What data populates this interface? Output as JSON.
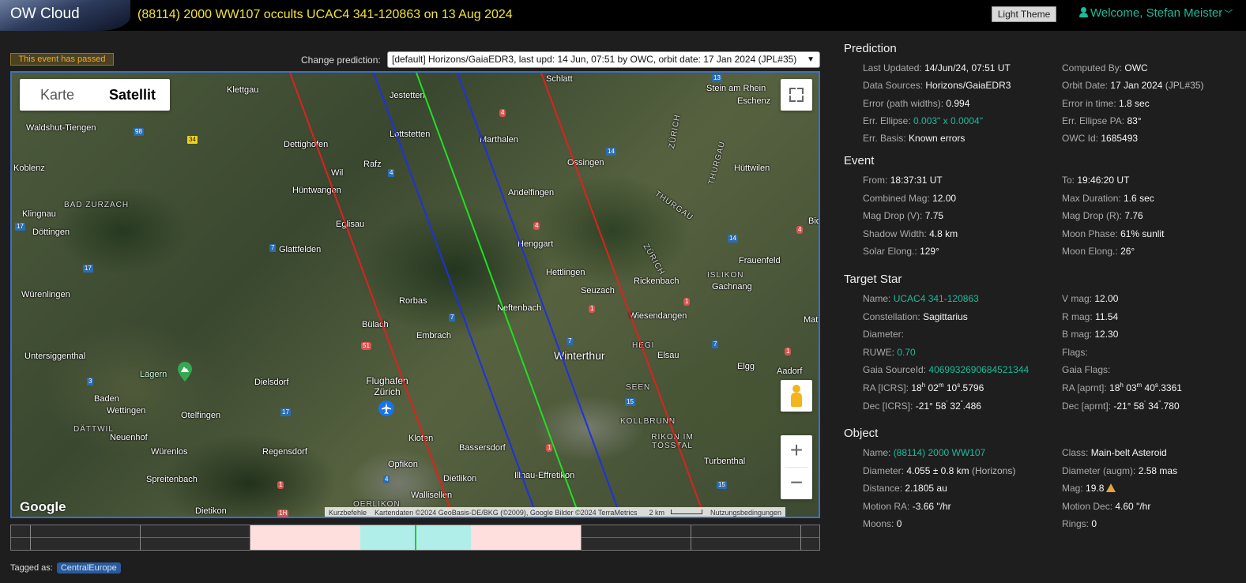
{
  "header": {
    "brand": "OW Cloud",
    "event_title": "(88114) 2000 WW107 occults UCAC4 341-120863 on 13 Aug 2024",
    "theme_button": "Light Theme",
    "welcome": "Welcome, Stefan Meister"
  },
  "controls": {
    "passed_badge": "This event has passed",
    "change_label": "Change prediction:",
    "prediction_selected": "[default] Horizons/GaiaEDR3, last upd: 14 Jun, 07:51 by OWC, orbit date: 17 Jan 2024 (JPL#35)"
  },
  "map": {
    "type_options": [
      "Karte",
      "Satellit"
    ],
    "type_selected": "Satellit",
    "google": "Google",
    "attribution": {
      "shortcuts": "Kurzbefehle",
      "data": "Kartendaten ©2024 GeoBasis-DE/BKG (©2009), Google Bilder ©2024 TerraMetrics",
      "scale": "2 km",
      "terms": "Nutzungsbedingungen"
    },
    "places": {
      "klettgau": "Klettgau",
      "waldshut": "Waldshut-Tiengen",
      "dettighofen": "Dettighofen",
      "koblenz": "Koblenz",
      "wil": "Wil",
      "rafz": "Rafz",
      "huentwangen": "Hüntwangen",
      "jestetten": "Jestetten",
      "lottstetten": "Lottstetten",
      "marthalen": "Marthalen",
      "schlatt": "Schlatt",
      "stein": "Stein am Rhein",
      "eschenz": "Eschenz",
      "ossingen": "Ossingen",
      "huettwilen": "Hüttwilen",
      "klingnau": "Klingnau",
      "bad_zurzach": "BAD ZURZACH",
      "doettingen": "Döttingen",
      "eglisau": "Eglisau",
      "andelfingen": "Andelfingen",
      "glattfelden": "Glattfelden",
      "henggart": "Henggart",
      "frauenfeld": "Frauenfeld",
      "wuerenlingen": "Würenlingen",
      "hettlingen": "Hettlingen",
      "rickenbach": "Rickenbach",
      "islikon": "ISLIKON",
      "gachnang": "Gachnang",
      "seuzach": "Seuzach",
      "rorbas": "Rorbas",
      "neftenbach": "Neftenbach",
      "wiesendangen": "Wiesendangen",
      "buelach": "Bülach",
      "embrach": "Embrach",
      "untersiggenthal": "Untersiggenthal",
      "winterthur": "Winterthur",
      "hegi": "HEGI",
      "elsau": "Elsau",
      "elgg": "Elgg",
      "aadorf": "Aadorf",
      "laegern": "Lägern",
      "dielsdorf": "Dielsdorf",
      "flughafen": "Flughafen Zürich",
      "seen": "SEEN",
      "baden": "Baden",
      "wettingen": "Wettingen",
      "otelfingen": "Otelfingen",
      "dattwil": "DÄTTWIL",
      "neuenhof": "Neuenhof",
      "kollbrunn": "KOLLBRUNN",
      "rikon": "RIKON IM TÖSSTAL",
      "kloten": "Kloten",
      "wuerenlos": "Würenlos",
      "regensdorf": "Regensdorf",
      "bassersdorf": "Bassersdorf",
      "turbenthal": "Turbenthal",
      "opfikon": "Opfikon",
      "spreitenbach": "Spreitenbach",
      "illnau": "Illnau-Effretikon",
      "dietlikon": "Dietlikon",
      "wallisellen": "Wallisellen",
      "dietikon": "Dietikon",
      "oerlikon": "OERLIKON",
      "zuerich1": "ZÜRICH",
      "zuerich2": "ZÜRICH",
      "thurgau1": "THURGAU",
      "thurgau2": "THURGAU",
      "mat": "Mat",
      "bic": "Bic"
    },
    "shields": [
      "98",
      "34",
      "4",
      "4",
      "4",
      "14",
      "13",
      "17",
      "7",
      "17",
      "4",
      "14",
      "7",
      "1",
      "7",
      "1",
      "51",
      "7",
      "1",
      "3",
      "17",
      "15",
      "1",
      "4",
      "15",
      "1",
      "1H",
      "7"
    ]
  },
  "timeline": {
    "colors": {
      "pink": "#ffdede",
      "cyan": "#b0eeea",
      "center": "#22cc22"
    }
  },
  "tags": {
    "label": "Tagged as:",
    "items": [
      "CentralEurope"
    ]
  },
  "prediction": {
    "title": "Prediction",
    "last_updated_k": "Last Updated:",
    "last_updated": "14/Jun/24, 07:51 UT",
    "computed_by_k": "Computed By:",
    "computed_by": "OWC",
    "data_sources_k": "Data Sources:",
    "data_sources": "Horizons/GaiaEDR3",
    "orbit_date_k": "Orbit Date:",
    "orbit_date": "17 Jan 2024",
    "orbit_date_paren": "(JPL#35)",
    "error_paths_k": "Error (path widths):",
    "error_paths": "0.994",
    "error_time_k": "Error in time:",
    "error_time": "1.8 sec",
    "err_ellipse_k": "Err. Ellipse:",
    "err_ellipse": "0.003\" x 0.0004\"",
    "err_ellipse_pa_k": "Err. Ellipse PA:",
    "err_ellipse_pa": "83°",
    "err_basis_k": "Err. Basis:",
    "err_basis": "Known errors",
    "owc_id_k": "OWC Id:",
    "owc_id": "1685493"
  },
  "event": {
    "title": "Event",
    "from_k": "From:",
    "from": "18:37:31 UT",
    "to_k": "To:",
    "to": "19:46:20 UT",
    "combined_mag_k": "Combined Mag:",
    "combined_mag": "12.00",
    "max_duration_k": "Max Duration:",
    "max_duration": "1.6 sec",
    "mag_drop_v_k": "Mag Drop (V):",
    "mag_drop_v": "7.75",
    "mag_drop_r_k": "Mag Drop (R):",
    "mag_drop_r": "7.76",
    "shadow_width_k": "Shadow Width:",
    "shadow_width": "4.8 km",
    "moon_phase_k": "Moon Phase:",
    "moon_phase": "61% sunlit",
    "solar_elong_k": "Solar Elong.:",
    "solar_elong": "129°",
    "moon_elong_k": "Moon Elong.:",
    "moon_elong": "26°"
  },
  "target_star": {
    "title": "Target Star",
    "name_k": "Name:",
    "name": "UCAC4 341-120863",
    "vmag_k": "V mag:",
    "vmag": "12.00",
    "constellation_k": "Constellation:",
    "constellation": "Sagittarius",
    "rmag_k": "R mag:",
    "rmag": "11.54",
    "diameter_k": "Diameter:",
    "diameter": "",
    "bmag_k": "B mag:",
    "bmag": "12.30",
    "ruwe_k": "RUWE:",
    "ruwe": "0.70",
    "flags_k": "Flags:",
    "flags": "",
    "gaia_id_k": "Gaia SourceId:",
    "gaia_id": "4069932690684521344",
    "gaia_flags_k": "Gaia Flags:",
    "gaia_flags": "",
    "ra_icrs_k": "RA [ICRS]:",
    "ra_icrs": [
      "18",
      "h",
      " 02",
      "m",
      " 10",
      "s",
      ".5796"
    ],
    "ra_aprnt_k": "RA [aprnt]:",
    "ra_aprnt": [
      "18",
      "h",
      " 03",
      "m",
      " 40",
      "s",
      ".3361"
    ],
    "dec_icrs_k": "Dec [ICRS]:",
    "dec_icrs": [
      "-21° 58",
      "'",
      " 32",
      "\"",
      ".486"
    ],
    "dec_aprnt_k": "Dec [aprnt]:",
    "dec_aprnt": [
      "-21° 58",
      "'",
      " 34",
      "\"",
      ".780"
    ]
  },
  "object": {
    "title": "Object",
    "name_k": "Name:",
    "name": "(88114) 2000 WW107",
    "class_k": "Class:",
    "class": "Main-belt Asteroid",
    "diameter_k": "Diameter:",
    "diameter": "4.055 ± 0.8 km",
    "diameter_paren": "(Horizons)",
    "diameter_augm_k": "Diameter (augm):",
    "diameter_augm": "2.58 mas",
    "distance_k": "Distance:",
    "distance": "2.1805 au",
    "mag_k": "Mag:",
    "mag": "19.8",
    "motion_ra_k": "Motion RA:",
    "motion_ra": "-3.66 \"/hr",
    "motion_dec_k": "Motion Dec:",
    "motion_dec": "4.60 \"/hr",
    "moons_k": "Moons:",
    "moons": "0",
    "rings_k": "Rings:",
    "rings": "0"
  }
}
